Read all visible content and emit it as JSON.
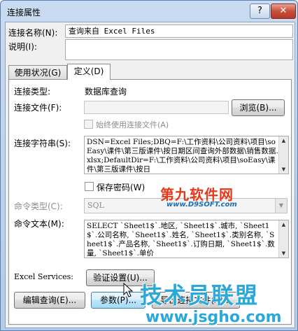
{
  "window": {
    "title": "连接属性",
    "help_btn": "?",
    "close_btn": "✕"
  },
  "top": {
    "name_label": "连接名称(N):",
    "name_value": "查询来自 Excel Files",
    "desc_label": "说明(I):",
    "desc_value": ""
  },
  "tabs": [
    {
      "label": "使用状况(G)"
    },
    {
      "label": "定义(D)"
    }
  ],
  "definition": {
    "conn_type_label": "连接类型:",
    "conn_type_value": "数据库查询",
    "conn_file_label": "连接文件(F):",
    "conn_file_value": "",
    "browse_btn": "浏览(B)...",
    "always_use_label": "始终使用连接文件(A)",
    "conn_string_label": "连接字符串(S):",
    "conn_string_value": "DSN=Excel Files;DBQ=F:\\工作资料\\公司资料\\项目\\soEasy\\课件\\第三版课件\\按日期区间查询外部数据\\销售数据.xlsx;DefaultDir=F:\\工作资料\\公司资料\\项目\\soEasy\\课件\\第三版课件\\按日",
    "save_pwd_label": "保存密码(W)",
    "cmd_type_label": "命令类型(C):",
    "cmd_type_value": "SQL",
    "cmd_text_label": "命令文本(M):",
    "cmd_text_value": "SELECT `Sheet1$`.地区, `Sheet1$`.城市, `Sheet1$`.公司名称, `Sheet1$`.姓名, `Sheet1$`.类别名称, `Sheet1$`.产品名称, `Sheet1$`.订购日期, `Sheet1$`.数量, `Sheet1$`.单价",
    "excel_services_label": "Excel Services:",
    "auth_btn": "验证设置(U)...",
    "edit_query_btn": "编辑查询(E)...",
    "params_btn": "参数(P)...",
    "export_btn": "导出连接文件(X)..."
  },
  "watermarks": {
    "site1": "第九软件网",
    "site1_url": "www.D9SOFT.com",
    "site2": "技术员联盟",
    "site2_url": "www.jsgho.com"
  }
}
